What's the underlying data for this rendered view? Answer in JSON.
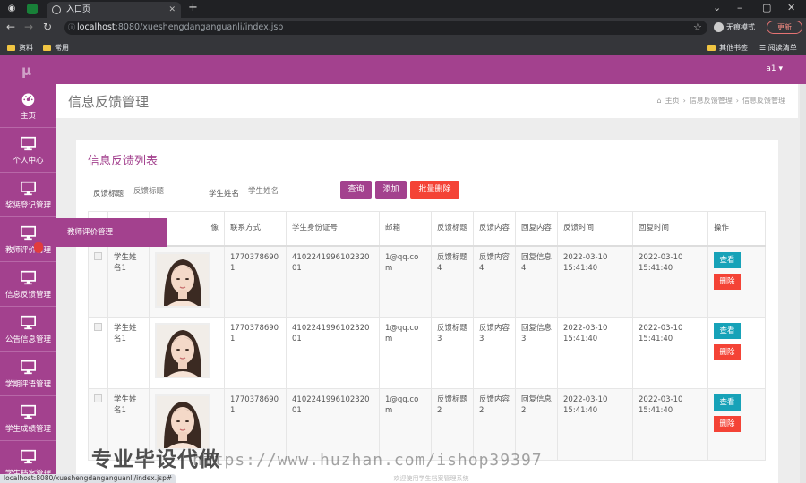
{
  "browser": {
    "tab_title": "入口页",
    "url_host": "localhost",
    "url_rest": ":8080/xueshengdanganguanli/index.jsp",
    "incognito_label": "无痕模式",
    "update_label": "更新",
    "bookmarks": [
      "资料",
      "常用"
    ],
    "bookmarks_right": [
      "其他书签",
      "阅读清单"
    ],
    "status_url": "localhost:8080/xueshengdanganguanli/index.jsp#"
  },
  "app": {
    "logo": "μ",
    "user": "a1 ▾"
  },
  "sidebar": {
    "items": [
      {
        "label": "主页",
        "icon": "dashboard-icon"
      },
      {
        "label": "个人中心",
        "icon": "monitor-icon"
      },
      {
        "label": "奖惩登记管理",
        "icon": "monitor-icon"
      },
      {
        "label": "教师评价管理",
        "icon": "monitor-icon"
      },
      {
        "label": "信息反馈管理",
        "icon": "monitor-icon"
      },
      {
        "label": "公告信息管理",
        "icon": "monitor-icon"
      },
      {
        "label": "学期评语管理",
        "icon": "monitor-icon"
      },
      {
        "label": "学生成绩管理",
        "icon": "monitor-icon"
      },
      {
        "label": "学生档案管理",
        "icon": "monitor-icon"
      }
    ],
    "flyout": "教师评价管理"
  },
  "header": {
    "title": "信息反馈管理",
    "breadcrumbs": [
      "主页",
      "信息反馈管理",
      "信息反馈管理"
    ]
  },
  "panel": {
    "title": "信息反馈列表",
    "filters": [
      {
        "label": "反馈标题",
        "placeholder": "反馈标题"
      },
      {
        "label": "学生姓名",
        "placeholder": "学生姓名"
      }
    ],
    "buttons": {
      "search": "查询",
      "add": "添加",
      "batch_delete": "批量删除"
    }
  },
  "table": {
    "columns": [
      "",
      "",
      "像",
      "联系方式",
      "学生身份证号",
      "邮箱",
      "反馈标题",
      "反馈内容",
      "回复内容",
      "反馈时间",
      "回复时间",
      "操作"
    ],
    "rows": [
      {
        "name": "学生姓名1",
        "phone": "17703786901",
        "idcard": "410224199610232001",
        "email": "1@qq.com",
        "title": "反馈标题4",
        "content": "反馈内容4",
        "reply": "回复信息4",
        "time": "2022-03-10 15:41:40",
        "reply_time": "2022-03-10 15:41:40"
      },
      {
        "name": "学生姓名1",
        "phone": "17703786901",
        "idcard": "410224199610232001",
        "email": "1@qq.com",
        "title": "反馈标题3",
        "content": "反馈内容3",
        "reply": "回复信息3",
        "time": "2022-03-10 15:41:40",
        "reply_time": "2022-03-10 15:41:40"
      },
      {
        "name": "学生姓名1",
        "phone": "17703786901",
        "idcard": "410224199610232001",
        "email": "1@qq.com",
        "title": "反馈标题2",
        "content": "反馈内容2",
        "reply": "回复信息2",
        "time": "2022-03-10 15:41:40",
        "reply_time": "2022-03-10 15:41:40"
      }
    ],
    "view_label": "查看",
    "delete_label": "删除"
  },
  "footer": "欢迎使用学生档案管理系统",
  "watermark": {
    "text": "专业毕设代做",
    "url": "https://www.huzhan.com/ishop39397"
  },
  "colors": {
    "primary": "#a3418e",
    "danger": "#f44336",
    "info": "#17a2b8"
  }
}
